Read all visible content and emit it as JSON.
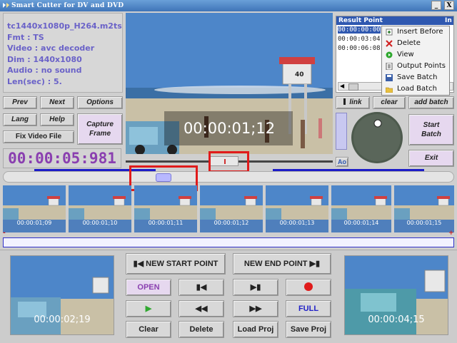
{
  "window": {
    "title": "Smart Cutter for DV and DVD",
    "controls": {
      "minimize": "_",
      "close": "X"
    }
  },
  "file_info": {
    "filename": "tc1440x1080p_H264.m2ts",
    "fmt": "Fmt : TS",
    "video": "Video : avc decoder",
    "dim": "Dim : 1440x1080",
    "audio": "Audio : no sound",
    "len": "Len(sec) : 5."
  },
  "left_buttons": {
    "prev": "Prev",
    "next": "Next",
    "options": "Options",
    "lang": "Lang",
    "help": "Help",
    "capture": "Capture\nFrame",
    "fix": "Fix Video File"
  },
  "current_time": "00:00:05:981",
  "preview": {
    "timecode": "00:00:01;12",
    "sign": "40"
  },
  "result_panel": {
    "header": "Result Point",
    "header_right": "In",
    "rows": [
      "00:00:00:00",
      "00:00:03:04",
      "00:00:06:08"
    ]
  },
  "context_menu": {
    "items": [
      {
        "label": "Insert Before",
        "icon": "insert-icon"
      },
      {
        "label": "Delete",
        "icon": "delete-x-icon"
      },
      {
        "label": "View",
        "icon": "view-icon"
      },
      {
        "label": "Output Points",
        "icon": "output-points-icon"
      },
      {
        "label": "Save Batch",
        "icon": "save-icon"
      },
      {
        "label": "Load Batch",
        "icon": "load-icon"
      }
    ]
  },
  "right_buttons": {
    "link": "link",
    "clear": "clear",
    "add_batch": "add batch",
    "start_batch": "Start\nBatch",
    "exit": "Exit",
    "ao": "Ao"
  },
  "frames": [
    "00:00:01;09",
    "00:00:01;10",
    "00:00:01;11",
    "00:00:01;12",
    "00:00:01;13",
    "00:00:01;14",
    "00:00:01;15"
  ],
  "bottom": {
    "start_thumb_tc": "00:00:02;19",
    "end_thumb_tc": "00:00:04;15",
    "new_start": "NEW START POINT",
    "new_end": "NEW END POINT",
    "open": "OPEN",
    "full": "FULL",
    "clear": "Clear",
    "delete": "Delete",
    "load_proj": "Load Proj",
    "save_proj": "Save Proj"
  },
  "colors": {
    "accent_purple": "#8a3fb0",
    "info_text": "#6a62c8",
    "header_blue": "#2f58b0",
    "annotation_red": "#e01b1b"
  }
}
